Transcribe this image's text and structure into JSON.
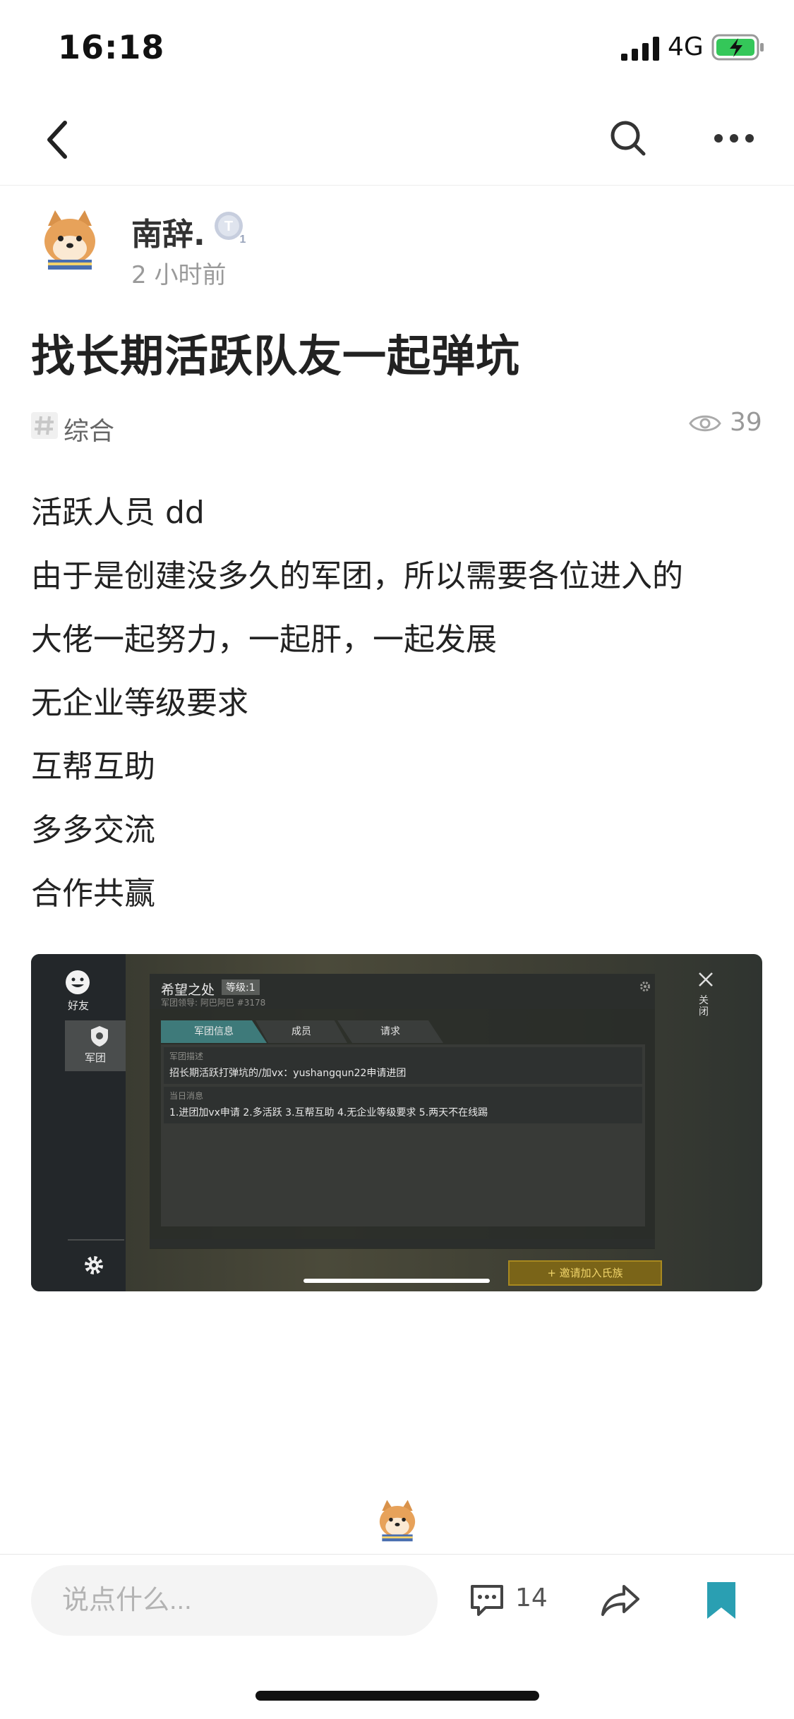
{
  "status_bar": {
    "time": "16:18",
    "network": "4G"
  },
  "post": {
    "author": "南辞.",
    "time_ago": "2 小时前",
    "title": "找长期活跃队友一起弹坑",
    "tag": "综合",
    "views": "39",
    "body_lines": [
      "活跃人员 dd",
      "由于是创建没多久的军团，所以需要各位进入的",
      "大佬一起努力，一起肝，一起发展",
      "无企业等级要求",
      "互帮互助",
      "多多交流",
      "合作共赢"
    ]
  },
  "screenshot": {
    "sidebar": {
      "friends": "好友",
      "legion": "军团"
    },
    "legion_name": "希望之处",
    "level": "等级:1",
    "leader": "军团领导: 阿巴阿巴 #3178",
    "tabs": [
      "军团信息",
      "成员",
      "请求"
    ],
    "desc_label": "军团描述",
    "desc": "招长期活跃打弹坑的/加vx：yushangqun22申请进团",
    "news_label": "当日消息",
    "news": "1.进团加vx申请 2.多活跃 3.互帮互助 4.无企业等级要求 5.两天不在线踢",
    "invite": "+ 邀请加入氏族",
    "close": "关闭"
  },
  "bottom_bar": {
    "comment_placeholder": "说点什么...",
    "comment_count": "14"
  },
  "colors": {
    "bookmark": "#2a9fb2",
    "text": "#222222",
    "muted": "#9a9a9a"
  }
}
